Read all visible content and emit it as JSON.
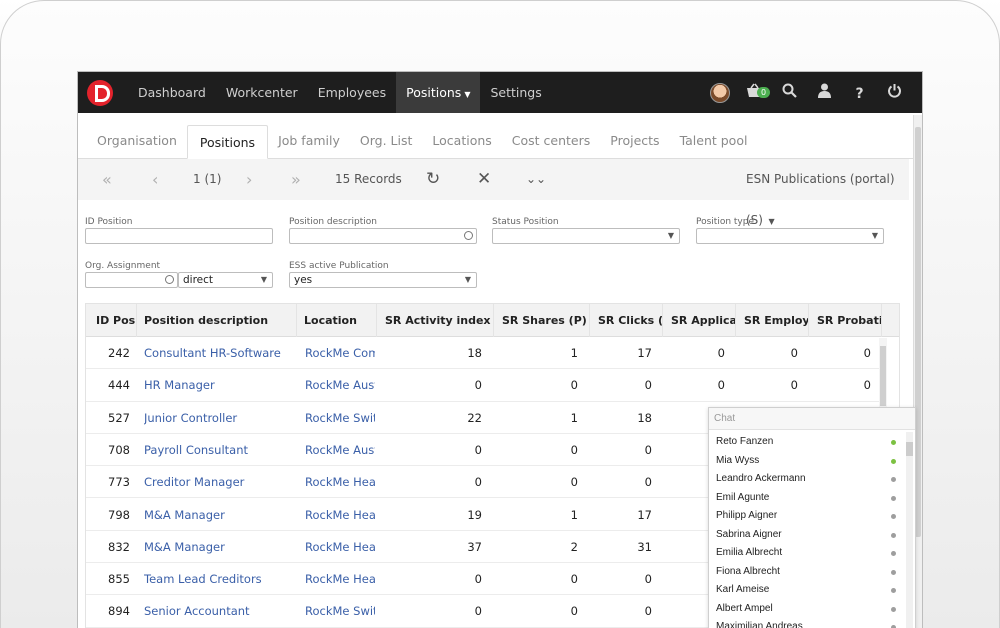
{
  "nav": {
    "items": [
      "Dashboard",
      "Workcenter",
      "Employees",
      "Positions",
      "Settings"
    ],
    "active": "Positions",
    "cart_badge": "0"
  },
  "tabs": [
    "Organisation",
    "Positions",
    "Job family",
    "Org. List",
    "Locations",
    "Cost centers",
    "Projects",
    "Talent pool"
  ],
  "toolbar": {
    "page": "1 (1)",
    "records": "15 Records",
    "portal": "ESN Publications (portal) (S)"
  },
  "filters": {
    "id_position": {
      "label": "ID Position",
      "value": ""
    },
    "position_description": {
      "label": "Position description",
      "value": ""
    },
    "status_position": {
      "label": "Status Position",
      "value": ""
    },
    "position_type": {
      "label": "Position type",
      "value": ""
    },
    "org_assignment": {
      "label": "Org. Assignment",
      "value": "",
      "mode": "direct"
    },
    "ess_active_publication": {
      "label": "ESS active Publication",
      "value": "yes"
    }
  },
  "table": {
    "columns": [
      "ID Posit",
      "Position description",
      "Location",
      "SR Activity index (P)",
      "SR Shares (P)",
      "SR Clicks (P)",
      "SR Applicati",
      "SR Employm",
      "SR Probation"
    ],
    "rows": [
      [
        "242",
        "Consultant HR-Software",
        "RockMe Comp",
        "18",
        "1",
        "17",
        "0",
        "0",
        "0"
      ],
      [
        "444",
        "HR Manager",
        "RockMe Austri",
        "0",
        "0",
        "0",
        "0",
        "0",
        "0"
      ],
      [
        "527",
        "Junior Controller",
        "RockMe Switze",
        "22",
        "1",
        "18",
        "",
        "",
        ""
      ],
      [
        "708",
        "Payroll Consultant",
        "RockMe Austri",
        "0",
        "0",
        "0",
        "",
        "",
        ""
      ],
      [
        "773",
        "Creditor Manager",
        "RockMe Headc",
        "0",
        "0",
        "0",
        "",
        "",
        ""
      ],
      [
        "798",
        "M&A Manager",
        "RockMe Headc",
        "19",
        "1",
        "17",
        "",
        "",
        ""
      ],
      [
        "832",
        "M&A Manager",
        "RockMe Headc",
        "37",
        "2",
        "31",
        "",
        "",
        ""
      ],
      [
        "855",
        "Team Lead Creditors",
        "RockMe Headc",
        "0",
        "0",
        "0",
        "",
        "",
        ""
      ],
      [
        "894",
        "Senior Accountant",
        "RockMe Switze",
        "0",
        "0",
        "0",
        "",
        "",
        ""
      ]
    ]
  },
  "chat": {
    "title": "Chat",
    "users": [
      {
        "name": "Reto Fanzen",
        "online": true
      },
      {
        "name": "Mia Wyss",
        "online": true
      },
      {
        "name": "Leandro Ackermann",
        "online": false
      },
      {
        "name": "Emil Agunte",
        "online": false
      },
      {
        "name": "Philipp Aigner",
        "online": false
      },
      {
        "name": "Sabrina Aigner",
        "online": false
      },
      {
        "name": "Emilia Albrecht",
        "online": false
      },
      {
        "name": "Fiona Albrecht",
        "online": false
      },
      {
        "name": "Karl Ameise",
        "online": false
      },
      {
        "name": "Albert Ampel",
        "online": false
      },
      {
        "name": "Maximilian Andreas",
        "online": false
      }
    ]
  },
  "colors": {
    "online": "#7cc142",
    "offline": "#9e9e9e",
    "link": "#3a5fa8",
    "nav_bg": "#1e1e1e"
  }
}
